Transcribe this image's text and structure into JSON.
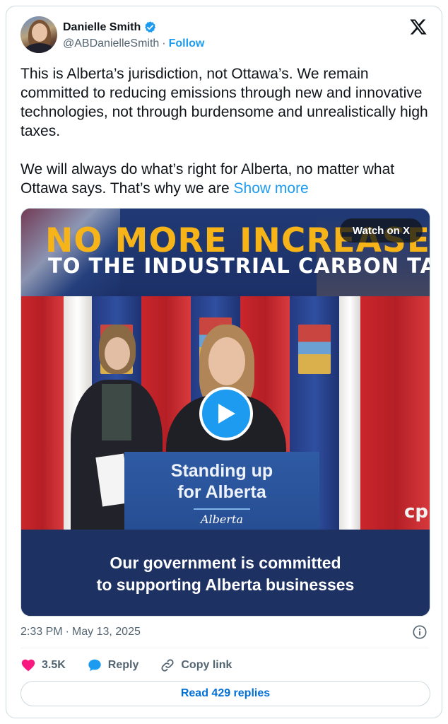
{
  "author": {
    "name": "Danielle Smith",
    "handle": "@ABDanielleSmith",
    "separator": "·",
    "follow_label": "Follow"
  },
  "tweet": {
    "paragraph1": "This is Alberta’s jurisdiction, not Ottawa’s. We remain committed to reducing emissions through new and innovative technologies, not through burdensome and unrealistically high taxes.",
    "paragraph2": "We will always do what’s right for Alberta, no matter what Ottawa says. That’s why we are",
    "show_more_label": "Show more"
  },
  "media": {
    "headline_line1": "NO MORE INCREASES",
    "headline_line2": "TO THE INDUSTRIAL CARBON TAX",
    "watch_label": "Watch on X",
    "podium_line1": "Standing up",
    "podium_line2": "for Alberta",
    "podium_logo": "Alberta",
    "watermark": "cp",
    "caption_line1": "Our government is committed",
    "caption_line2": "to supporting Alberta businesses"
  },
  "meta": {
    "time": "2:33 PM",
    "separator": "·",
    "date": "May 13, 2025"
  },
  "actions": {
    "likes_count": "3.5K",
    "reply_label": "Reply",
    "copy_link_label": "Copy link"
  },
  "read_replies_label": "Read 429 replies",
  "colors": {
    "accent_blue": "#1d9bf0",
    "like_pink": "#f91880",
    "headline_yellow": "#f6b418",
    "banner_navy": "#213a75"
  },
  "icons": [
    "verified-badge-icon",
    "x-logo-icon",
    "play-icon",
    "info-icon",
    "heart-icon",
    "reply-bubble-icon",
    "link-icon"
  ]
}
